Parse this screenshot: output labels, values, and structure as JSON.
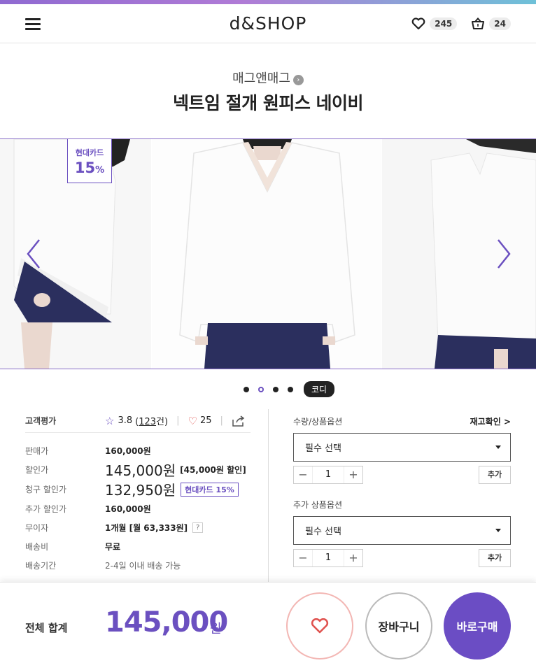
{
  "header": {
    "logo": "d&SHOP",
    "wishlist_count": "245",
    "cart_count": "24"
  },
  "product": {
    "brand": "매그앤매그",
    "title": "넥트임 절개 원피스 네이비"
  },
  "gallery": {
    "badge_label": "현대카드",
    "badge_value": "15",
    "badge_unit": "%",
    "codi_label": "코디",
    "dot_count": 4,
    "active_dot": 2
  },
  "info": {
    "rating_label": "고객평가",
    "rating_score": "3.8",
    "review_open": "(",
    "review_count": "123",
    "review_suffix": "건)",
    "like_count": "25",
    "rows": {
      "sale_price_label": "판매가",
      "sale_price": "160,000원",
      "discount_label": "할인가",
      "discount_price": "145,000원",
      "discount_note": "[45,000원 할인]",
      "billing_label": "청구 할인가",
      "billing_price": "132,950원",
      "billing_note": "현대카드 15%",
      "extra_label": "추가 할인가",
      "extra_price": "160,000원",
      "installment_label": "무이자",
      "installment_value": "1개월 [월 63,333원]",
      "help": "?",
      "shipping_label": "배송비",
      "shipping_value": "무료",
      "delivery_label": "배송기간",
      "delivery_value": "2-4일 이내 배송 가능"
    }
  },
  "options": {
    "qty_option_label": "수량/상품옵션",
    "stock_check_label": "재고확인",
    "stock_arrow": ">",
    "select_placeholder_1": "필수 선택",
    "qty_1": "1",
    "add_label_1": "추가",
    "extra_option_label": "추가 상품옵션",
    "select_placeholder_2": "필수 선택",
    "qty_2": "1",
    "add_label_2": "추가",
    "minus": "−",
    "plus": "+"
  },
  "footer": {
    "total_label": "전체 합계",
    "total_amount": "145,000",
    "total_unit": "원",
    "cart_label": "장바구니",
    "buy_label": "바로구매"
  },
  "colors": {
    "accent": "#6b50c0",
    "heart": "#e0524f"
  }
}
